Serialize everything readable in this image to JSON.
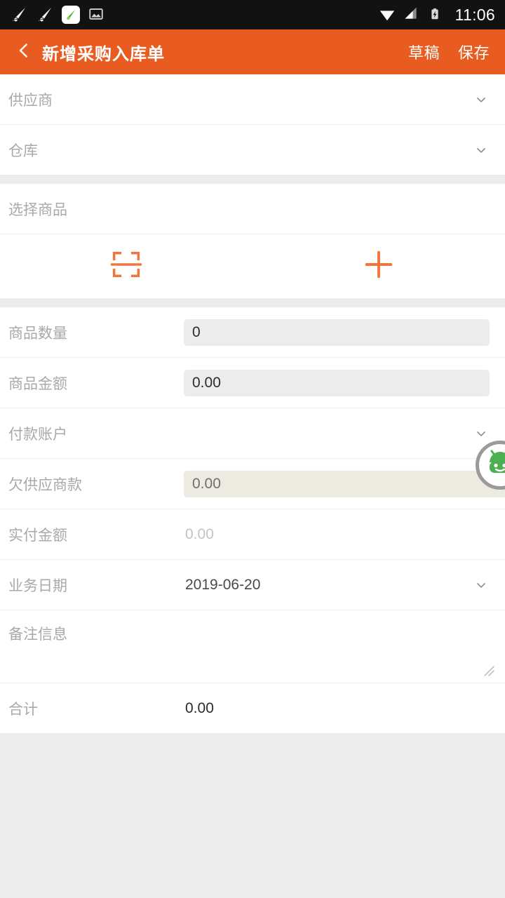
{
  "status_bar": {
    "time": "11:06",
    "notification_icons": [
      "app-notification-icon",
      "app-notification-icon",
      "app-badge-icon",
      "image-download-icon"
    ],
    "system_icons": [
      "wifi-icon",
      "cellular-signal-icon",
      "battery-charging-icon"
    ],
    "background_color": "#121212"
  },
  "app_bar": {
    "back_icon": "chevron-left-icon",
    "title": "新增采购入库单",
    "draft_label": "草稿",
    "save_label": "保存",
    "background_color": "#e85c22",
    "text_color": "#ffffff"
  },
  "section_top": {
    "supplier": {
      "label": "供应商",
      "value": "",
      "chevron": "chevron-down-icon"
    },
    "warehouse": {
      "label": "仓库",
      "value": "",
      "chevron": "chevron-down-icon"
    }
  },
  "section_goods": {
    "select_goods_label": "选择商品",
    "scan_icon": "barcode-scan-icon",
    "add_icon": "plus-icon",
    "accent_color": "#f4743b"
  },
  "section_detail": {
    "quantity": {
      "label": "商品数量",
      "value": "0"
    },
    "amount": {
      "label": "商品金额",
      "value": "0.00"
    },
    "payment_account": {
      "label": "付款账户",
      "value": "",
      "chevron": "chevron-down-icon"
    },
    "owed_to_supplier": {
      "label": "欠供应商款",
      "value": "0.00"
    },
    "actual_paid": {
      "label": "实付金额",
      "value": "0.00"
    },
    "business_date": {
      "label": "业务日期",
      "value": "2019-06-20",
      "chevron": "chevron-down-icon"
    },
    "remark": {
      "label": "备注信息",
      "value": "",
      "resize_handle": "resize-handle-icon"
    },
    "total": {
      "label": "合计",
      "value": "0.00"
    }
  },
  "assistant": {
    "icon": "android-assistant-icon",
    "color": "#4caf50",
    "ring_color": "#9a9a9a"
  }
}
